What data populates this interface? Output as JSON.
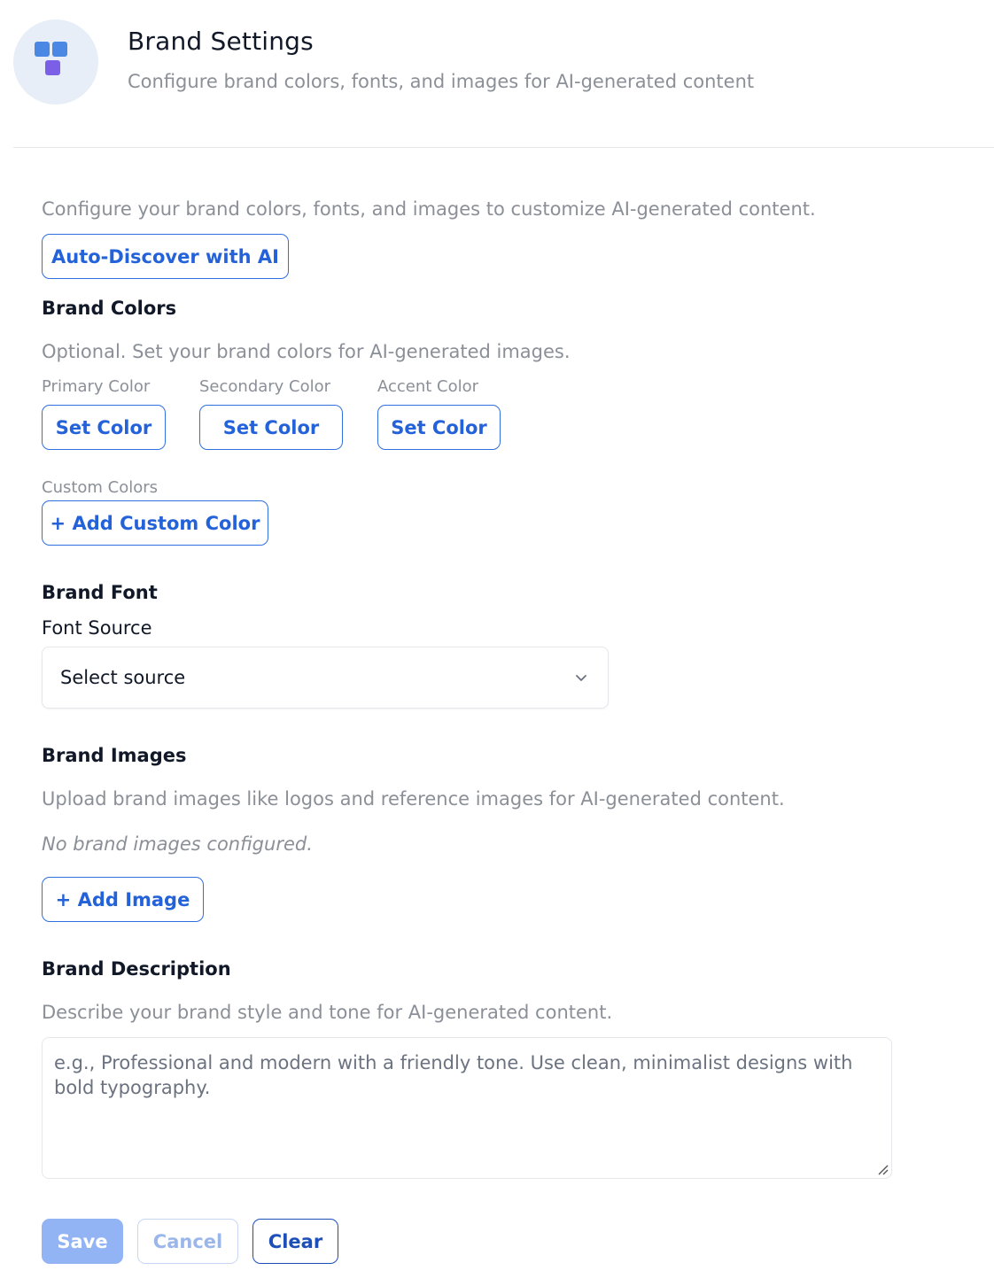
{
  "header": {
    "title": "Brand Settings",
    "subtitle": "Configure brand colors, fonts, and images for AI-generated content",
    "logo_icon": "brand-blocks-icon"
  },
  "intro": {
    "text": "Configure your brand colors, fonts, and images to customize AI-generated content.",
    "auto_discover_label": "Auto-Discover with AI"
  },
  "colors": {
    "title": "Brand Colors",
    "description": "Optional. Set your brand colors for AI-generated images.",
    "primary_label": "Primary Color",
    "secondary_label": "Secondary Color",
    "accent_label": "Accent Color",
    "set_color_label": "Set Color",
    "custom_label": "Custom Colors",
    "add_custom_label": "+ Add Custom Color"
  },
  "font": {
    "title": "Brand Font",
    "source_label": "Font Source",
    "source_value": "Select source"
  },
  "images": {
    "title": "Brand Images",
    "description": "Upload brand images like logos and reference images for AI-generated content.",
    "empty_text": "No brand images configured.",
    "add_label": "+ Add Image"
  },
  "description": {
    "title": "Brand Description",
    "help": "Describe your brand style and tone for AI-generated content.",
    "placeholder": "e.g., Professional and modern with a friendly tone. Use clean, minimalist designs with bold typography."
  },
  "actions": {
    "save": "Save",
    "cancel": "Cancel",
    "clear": "Clear"
  },
  "theme": {
    "accent": "#2462d9",
    "muted_text": "#8b8f97",
    "save_disabled": "#93b4f4"
  }
}
